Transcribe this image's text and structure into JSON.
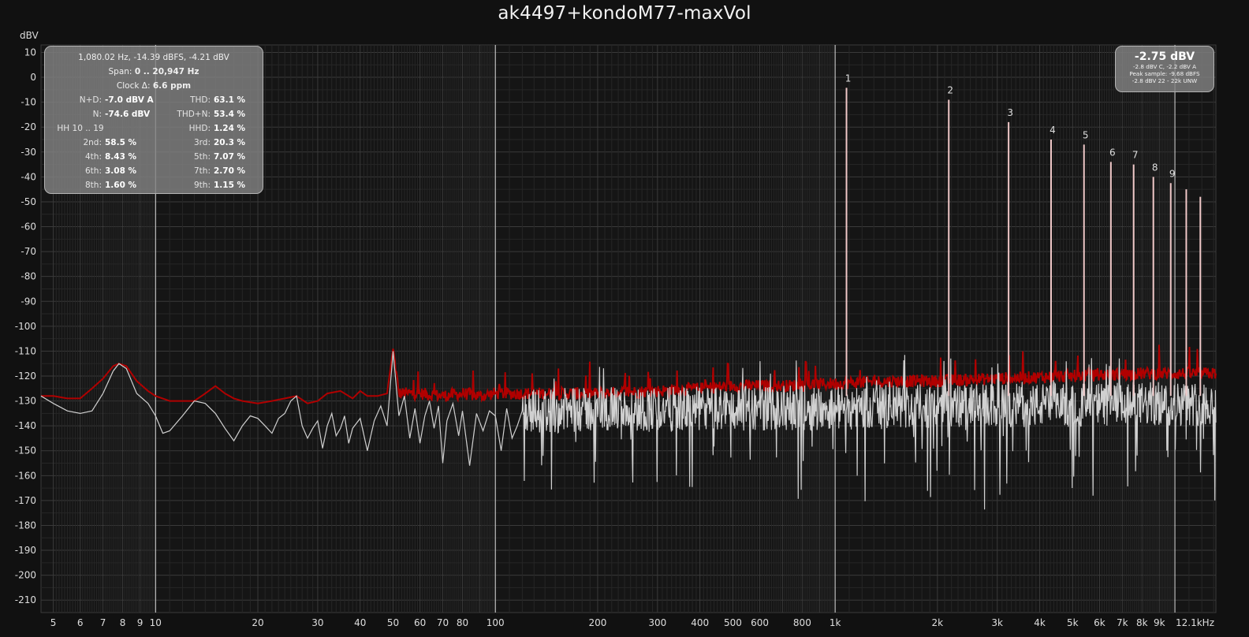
{
  "title": "ak4497+kondoM77-maxVol",
  "unit_label": "dBV",
  "info_panel": {
    "line1": "1,080.02 Hz, -14.39 dBFS, -4.21 dBV",
    "span_label": "Span:",
    "span_value": "0 .. 20,947 Hz",
    "clock_label": "Clock Δ:",
    "clock_value": "6.6 ppm",
    "rows": [
      {
        "l1": "N+D:",
        "v1": "-7.0 dBV A",
        "l2": "THD:",
        "v2": "63.1 %"
      },
      {
        "l1": "N:",
        "v1": "-74.6 dBV",
        "l2": "THD+N:",
        "v2": "53.4 %"
      },
      {
        "l1": "HH 10 .. 19",
        "v1": "",
        "l2": "HHD:",
        "v2": "1.24 %"
      },
      {
        "l1": "2nd:",
        "v1": "58.5 %",
        "l2": "3rd:",
        "v2": "20.3 %"
      },
      {
        "l1": "4th:",
        "v1": "8.43 %",
        "l2": "5th:",
        "v2": "7.07 %"
      },
      {
        "l1": "6th:",
        "v1": "3.08 %",
        "l2": "7th:",
        "v2": "2.70 %"
      },
      {
        "l1": "8th:",
        "v1": "1.60 %",
        "l2": "9th:",
        "v2": "1.15 %"
      }
    ]
  },
  "peak_panel": {
    "value": "-2.75 dBV",
    "line1": "-2.8 dBV C, -2.2 dBV A",
    "line2": "Peak sample: -9.68 dBFS",
    "line3": "-2.8 dBV 22 - 22k UNW"
  },
  "colors": {
    "background": "#111111",
    "grid_major": "#3a3a3a",
    "grid_minor": "#262626",
    "spectrum": "#d0d0d0",
    "peak_hold": "#b00000",
    "harmonic_bar": "#f0c8c8",
    "marker": "#d8d8d8"
  },
  "chart_data": {
    "type": "line",
    "x_scale": "log",
    "xlabel": "",
    "ylabel": "dBV",
    "xlim": [
      4.6,
      13200
    ],
    "ylim": [
      -215,
      13
    ],
    "grid": true,
    "y_ticks": [
      10,
      0,
      -10,
      -20,
      -30,
      -40,
      -50,
      -60,
      -70,
      -80,
      -90,
      -100,
      -110,
      -120,
      -130,
      -140,
      -150,
      -160,
      -170,
      -180,
      -190,
      -200,
      -210
    ],
    "x_ticks": [
      {
        "f": 5,
        "label": "5"
      },
      {
        "f": 6,
        "label": "6"
      },
      {
        "f": 7,
        "label": "7"
      },
      {
        "f": 8,
        "label": "8"
      },
      {
        "f": 9,
        "label": "9"
      },
      {
        "f": 10,
        "label": "10"
      },
      {
        "f": 20,
        "label": "20"
      },
      {
        "f": 30,
        "label": "30"
      },
      {
        "f": 40,
        "label": "40"
      },
      {
        "f": 50,
        "label": "50"
      },
      {
        "f": 60,
        "label": "60"
      },
      {
        "f": 70,
        "label": "70"
      },
      {
        "f": 80,
        "label": "80"
      },
      {
        "f": 100,
        "label": "100"
      },
      {
        "f": 200,
        "label": "200"
      },
      {
        "f": 300,
        "label": "300"
      },
      {
        "f": 400,
        "label": "400"
      },
      {
        "f": 500,
        "label": "500"
      },
      {
        "f": 600,
        "label": "600"
      },
      {
        "f": 800,
        "label": "800"
      },
      {
        "f": 1000,
        "label": "1k"
      },
      {
        "f": 2000,
        "label": "2k"
      },
      {
        "f": 3000,
        "label": "3k"
      },
      {
        "f": 4000,
        "label": "4k"
      },
      {
        "f": 5000,
        "label": "5k"
      },
      {
        "f": 6000,
        "label": "6k"
      },
      {
        "f": 7000,
        "label": "7k"
      },
      {
        "f": 8000,
        "label": "8k"
      },
      {
        "f": 9000,
        "label": "9k"
      },
      {
        "f": 12100,
        "label": "12.1kHz"
      }
    ],
    "marker_lines": [
      10,
      100,
      1000,
      10000
    ],
    "harmonics": [
      {
        "n": "1",
        "f": 1080,
        "db": -4.2
      },
      {
        "n": "2",
        "f": 2160,
        "db": -9
      },
      {
        "n": "3",
        "f": 3240,
        "db": -18
      },
      {
        "n": "4",
        "f": 4320,
        "db": -25
      },
      {
        "n": "5",
        "f": 5400,
        "db": -27
      },
      {
        "n": "6",
        "f": 6480,
        "db": -34
      },
      {
        "n": "7",
        "f": 7560,
        "db": -35
      },
      {
        "n": "8",
        "f": 8640,
        "db": -40
      },
      {
        "n": "9",
        "f": 9720,
        "db": -42.5
      },
      {
        "n": "",
        "f": 10800,
        "db": -45
      },
      {
        "n": "",
        "f": 11880,
        "db": -48
      }
    ],
    "series": [
      {
        "key": "peak_hold",
        "points": [
          [
            4.6,
            -128
          ],
          [
            5,
            -128
          ],
          [
            5.5,
            -129
          ],
          [
            6,
            -129
          ],
          [
            6.5,
            -125
          ],
          [
            7,
            -121
          ],
          [
            7.5,
            -116
          ],
          [
            7.8,
            -115
          ],
          [
            8.2,
            -116
          ],
          [
            8.8,
            -122
          ],
          [
            9.5,
            -126
          ],
          [
            10,
            -128
          ],
          [
            11,
            -130
          ],
          [
            12,
            -130
          ],
          [
            13,
            -130
          ],
          [
            14,
            -127
          ],
          [
            15,
            -124
          ],
          [
            16,
            -127
          ],
          [
            17,
            -129
          ],
          [
            18,
            -130
          ],
          [
            20,
            -131
          ],
          [
            22,
            -130
          ],
          [
            24,
            -129
          ],
          [
            26,
            -128
          ],
          [
            28,
            -131
          ],
          [
            30,
            -130
          ],
          [
            32,
            -127
          ],
          [
            35,
            -126
          ],
          [
            38,
            -129
          ],
          [
            40,
            -126
          ],
          [
            42,
            -128
          ],
          [
            45,
            -128
          ],
          [
            48,
            -127
          ],
          [
            50,
            -109
          ],
          [
            52,
            -127
          ],
          [
            55,
            -127
          ],
          [
            60,
            -127
          ],
          [
            70,
            -128
          ],
          [
            80,
            -127
          ],
          [
            90,
            -128
          ],
          [
            100,
            -127
          ],
          [
            150,
            -127
          ],
          [
            200,
            -127
          ],
          [
            300,
            -126
          ],
          [
            400,
            -125
          ],
          [
            500,
            -124
          ],
          [
            700,
            -124
          ],
          [
            1000,
            -123
          ],
          [
            1500,
            -122
          ],
          [
            2000,
            -122
          ],
          [
            3000,
            -121
          ],
          [
            5000,
            -120
          ],
          [
            8000,
            -119
          ],
          [
            10000,
            -119
          ],
          [
            13200,
            -119
          ]
        ]
      },
      {
        "key": "spectrum",
        "points": [
          [
            4.6,
            -128
          ],
          [
            5,
            -131
          ],
          [
            5.5,
            -134
          ],
          [
            6,
            -135
          ],
          [
            6.5,
            -134
          ],
          [
            7,
            -127
          ],
          [
            7.5,
            -118
          ],
          [
            7.8,
            -115
          ],
          [
            8.2,
            -117
          ],
          [
            8.8,
            -127
          ],
          [
            9.5,
            -131
          ],
          [
            10,
            -136
          ],
          [
            10.5,
            -143
          ],
          [
            11,
            -142
          ],
          [
            12,
            -136
          ],
          [
            13,
            -130
          ],
          [
            14,
            -131
          ],
          [
            15,
            -135
          ],
          [
            16,
            -141
          ],
          [
            17,
            -146
          ],
          [
            18,
            -140
          ],
          [
            19,
            -136
          ],
          [
            20,
            -137
          ],
          [
            21,
            -140
          ],
          [
            22,
            -143
          ],
          [
            23,
            -137
          ],
          [
            24,
            -135
          ],
          [
            25,
            -130
          ],
          [
            26,
            -128
          ],
          [
            27,
            -140
          ],
          [
            28,
            -145
          ],
          [
            29,
            -141
          ],
          [
            30,
            -138
          ],
          [
            31,
            -149
          ],
          [
            32,
            -140
          ],
          [
            33,
            -135
          ],
          [
            34,
            -144
          ],
          [
            35,
            -141
          ],
          [
            36,
            -136
          ],
          [
            37,
            -147
          ],
          [
            38,
            -141
          ],
          [
            40,
            -137
          ],
          [
            42,
            -150
          ],
          [
            44,
            -138
          ],
          [
            46,
            -132
          ],
          [
            48,
            -140
          ],
          [
            50,
            -110
          ],
          [
            52,
            -136
          ],
          [
            54,
            -128
          ],
          [
            56,
            -145
          ],
          [
            58,
            -133
          ],
          [
            60,
            -147
          ],
          [
            62,
            -136
          ],
          [
            64,
            -130
          ],
          [
            66,
            -141
          ],
          [
            68,
            -132
          ],
          [
            70,
            -155
          ],
          [
            72,
            -138
          ],
          [
            75,
            -131
          ],
          [
            78,
            -144
          ],
          [
            80,
            -134
          ],
          [
            84,
            -156
          ],
          [
            88,
            -135
          ],
          [
            92,
            -142
          ],
          [
            96,
            -134
          ],
          [
            100,
            -136
          ],
          [
            104,
            -150
          ],
          [
            108,
            -133
          ],
          [
            112,
            -145
          ],
          [
            116,
            -140
          ],
          [
            120,
            -134
          ]
        ],
        "noise_from": 120,
        "noise_to": 13200,
        "noise_center": -134,
        "noise_spread": 9,
        "dip_min": -170,
        "sample_count": 1400
      }
    ]
  }
}
